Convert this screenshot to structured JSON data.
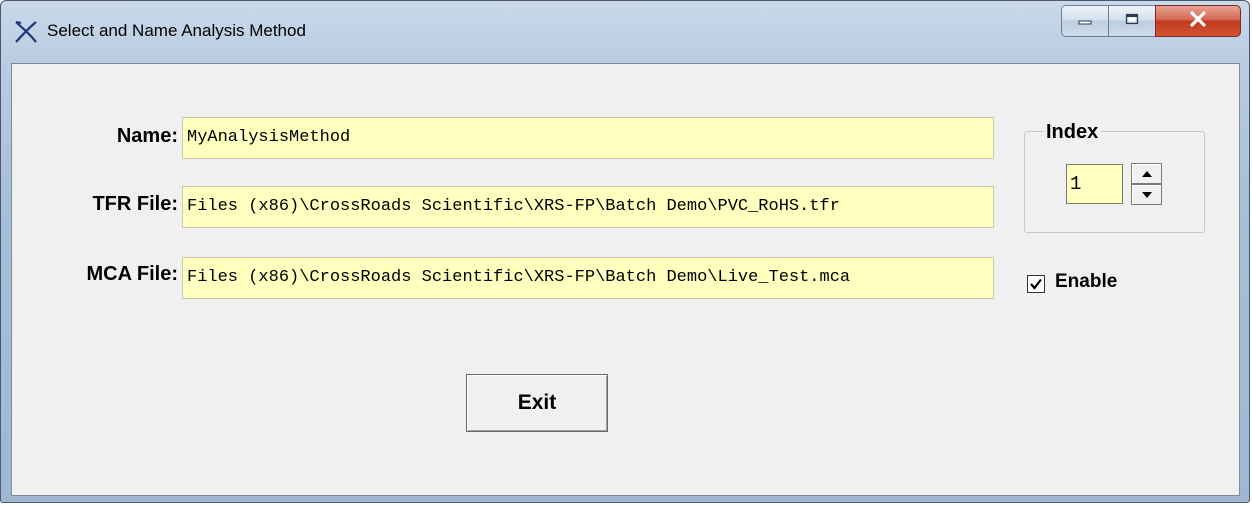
{
  "window": {
    "title": "Select and Name Analysis Method",
    "app_icon": "crossroads-x-icon",
    "controls": {
      "minimize_icon": "minimize-icon",
      "maximize_icon": "maximize-icon",
      "close_icon": "close-icon"
    }
  },
  "form": {
    "name_label": "Name:",
    "name_value": "MyAnalysisMethod",
    "tfr_label": "TFR File:",
    "tfr_value": " Files (x86)\\CrossRoads Scientific\\XRS-FP\\Batch Demo\\PVC_RoHS.tfr",
    "mca_label": "MCA File:",
    "mca_value": "Files (x86)\\CrossRoads Scientific\\XRS-FP\\Batch Demo\\Live_Test.mca"
  },
  "index": {
    "label": "Index",
    "value": "1",
    "spin_up_icon": "arrow-up-icon",
    "spin_down_icon": "arrow-down-icon"
  },
  "enable": {
    "label": "Enable",
    "checked": true
  },
  "buttons": {
    "exit_label": "Exit"
  },
  "colors": {
    "field_background": "#ffffc0",
    "client_background": "#f0f0f0",
    "close_button": "#c23a21"
  }
}
